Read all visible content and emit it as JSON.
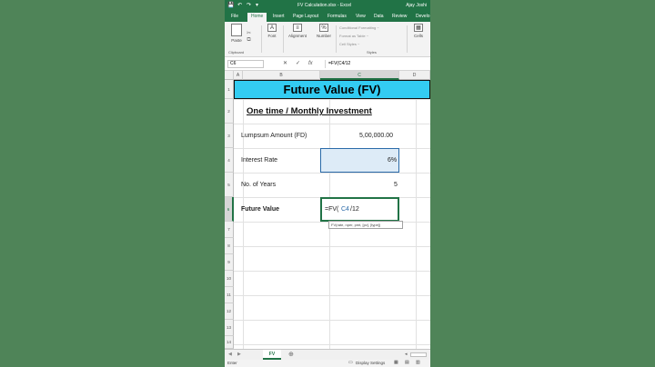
{
  "titlebar": {
    "file_title": "FV Calculation.xlsx - Excel",
    "user": "Ajay Joshi",
    "save_glyph": "💾",
    "undo_glyph": "↶",
    "redo_glyph": "↷",
    "custom_glyph": "▾"
  },
  "tabs": [
    "File",
    "Home",
    "Insert",
    "Page Layout",
    "Formulas",
    "View",
    "Data",
    "Review",
    "Develo"
  ],
  "ribbon": {
    "paste": "Paste",
    "clipboard": "Clipboard",
    "font": "Font",
    "alignment": "Alignment",
    "number": "Number",
    "conditional_formatting": "Conditional Formatting ~",
    "format_as_table": "Format as Table ~",
    "cell_styles": "Cell Styles ~",
    "styles": "Styles",
    "cells": "Cells"
  },
  "formula_bar": {
    "name_box": "C6",
    "cancel": "✕",
    "enter": "✓",
    "fx": "fx",
    "formula": "=FV(C4/12"
  },
  "columns": [
    "A",
    "B",
    "C",
    "D"
  ],
  "rows": [
    "1",
    "2",
    "3",
    "4",
    "5",
    "6",
    "7",
    "8",
    "9",
    "10",
    "11",
    "12",
    "13",
    "14"
  ],
  "sheet": {
    "banner": "Future Value (FV)",
    "subheading": "One time  / Monthly Investment",
    "rows": [
      {
        "label": "Lumpsum Amount (FD)",
        "value": "5,00,000.00"
      },
      {
        "label": "Interest Rate",
        "value": "6%"
      },
      {
        "label": "No. of Years",
        "value": "5"
      },
      {
        "label": "Future Value",
        "value_prefix": "=FV(",
        "value_ref": "C4",
        "value_suffix": "/12"
      }
    ],
    "tooltip": "FV(rate, nper, pmt, [pv], [type])"
  },
  "sheet_tabs": [
    "FV"
  ],
  "status": {
    "mode": "Enter",
    "display_settings": "Display Settings"
  }
}
